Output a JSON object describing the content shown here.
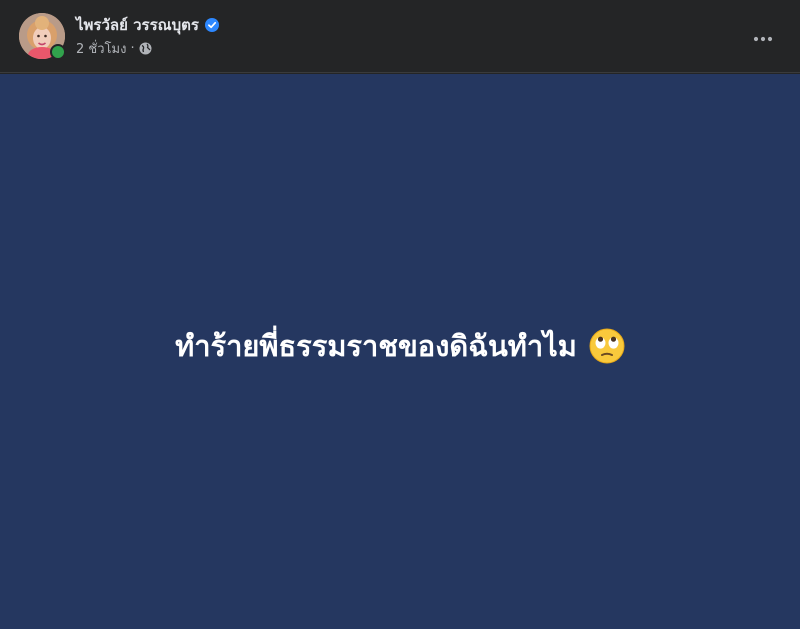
{
  "post": {
    "author": {
      "name": "ไพรวัลย์ วรรณบุตร",
      "verified": true,
      "online": true,
      "avatar_icon": "profile-photo"
    },
    "meta": {
      "time": "2 ชั่วโมง",
      "separator": "·",
      "audience_icon": "globe-icon"
    },
    "more_icon": "ellipsis-icon",
    "content": {
      "text": "ทำร้ายพี่ธรรมราชของดิฉันทำไม",
      "emoji": "face-with-rolling-eyes"
    },
    "colors": {
      "header_bg": "#242526",
      "background": "#253760",
      "verified": "#2d88ff",
      "online": "#31a24c",
      "text": "#ffffff"
    }
  }
}
